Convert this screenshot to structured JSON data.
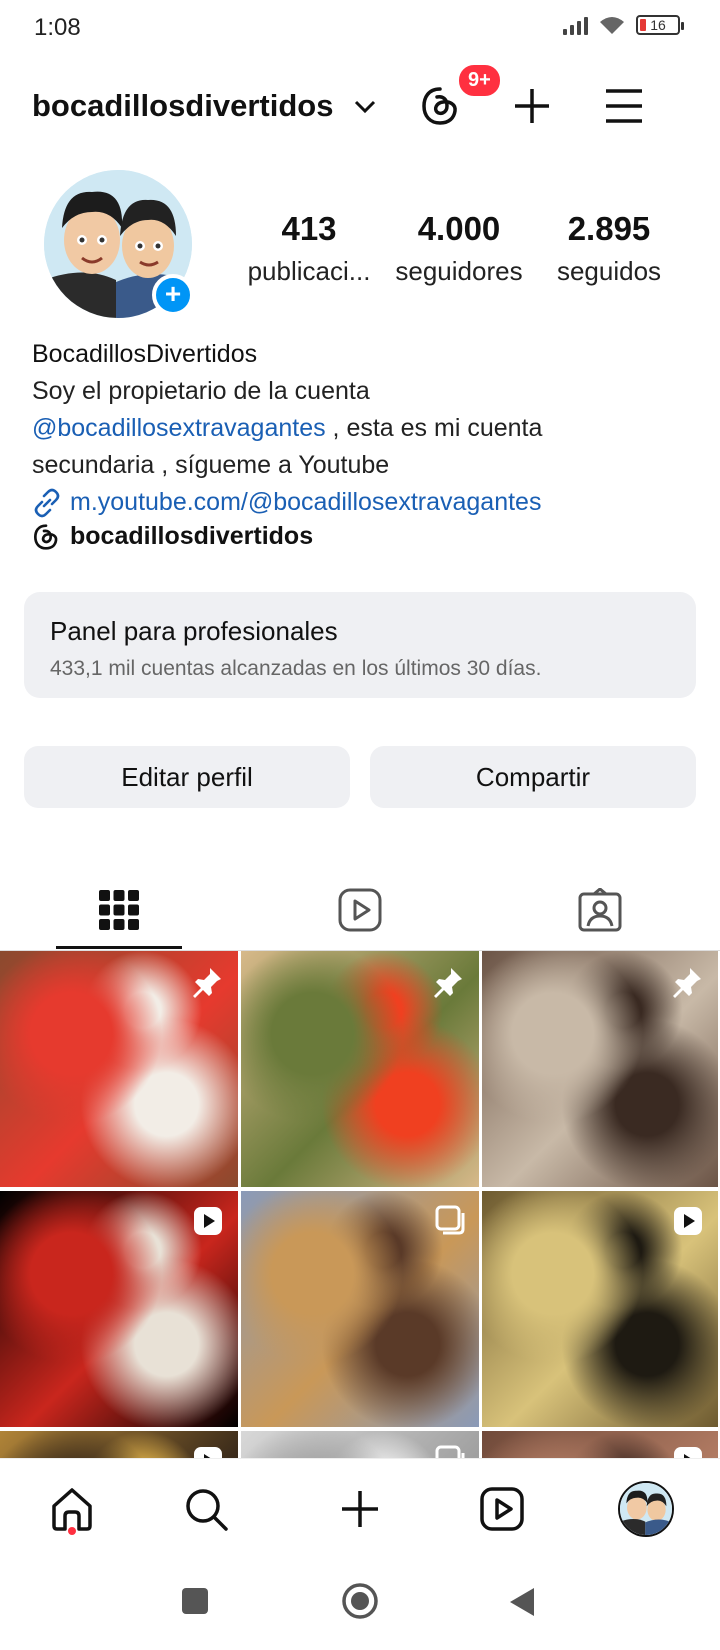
{
  "status_bar": {
    "time": "1:08",
    "battery": "16"
  },
  "header": {
    "username": "bocadillosdivertidos",
    "threads_badge": "9+",
    "icons": [
      "chevron-down-icon",
      "threads-icon",
      "plus-icon",
      "menu-icon"
    ]
  },
  "profile": {
    "stats": [
      {
        "value": "413",
        "label": "publicaci..."
      },
      {
        "value": "4.000",
        "label": "seguidores"
      },
      {
        "value": "2.895",
        "label": "seguidos"
      }
    ],
    "name": "BocadillosDivertidos",
    "bio_line1": "Soy el propietario de la cuenta",
    "bio_mention": "@bocadillosextravagantes",
    "bio_line2_rest": " , esta es mi cuenta",
    "bio_line3": "secundaria , sígueme a Youtube",
    "link": "m.youtube.com/@bocadillosextravagantes",
    "threads_handle": "bocadillosdivertidos"
  },
  "pro_panel": {
    "title": "Panel para profesionales",
    "subtitle": "433,1 mil cuentas alcanzadas en los últimos 30 días."
  },
  "actions": {
    "edit": "Editar perfil",
    "share": "Compartir"
  },
  "tabs": [
    "grid-icon",
    "reels-icon",
    "tagged-icon"
  ],
  "grid": [
    {
      "icon": "pin-icon",
      "colors": [
        "#8a4a2e",
        "#e63a2e",
        "#f2ede6"
      ]
    },
    {
      "icon": "pin-icon",
      "colors": [
        "#d7b98a",
        "#6a7a3a",
        "#f04020"
      ]
    },
    {
      "icon": "pin-icon",
      "colors": [
        "#6b5446",
        "#c8b9a7",
        "#3a2a22"
      ]
    },
    {
      "icon": "reel-icon",
      "colors": [
        "#000000",
        "#c9261d",
        "#e8e1d6"
      ]
    },
    {
      "icon": "carousel-icon",
      "colors": [
        "#8a9ab8",
        "#c99858",
        "#5a3a28"
      ]
    },
    {
      "icon": "reel-icon",
      "colors": [
        "#6d5a30",
        "#d8c27a",
        "#1e1a12"
      ]
    },
    {
      "icon": "reel-icon",
      "colors": [
        "#b08438",
        "#3a2a1a",
        "#f0c050"
      ]
    },
    {
      "icon": "carousel-icon",
      "colors": [
        "#d8d8d8",
        "#a0a0a0",
        "#f4f4f4"
      ]
    },
    {
      "icon": "reel-icon",
      "colors": [
        "#704a3a",
        "#b07a62",
        "#3a2620"
      ]
    }
  ],
  "bottom_nav": [
    "home-icon",
    "search-icon",
    "create-icon",
    "reels-icon",
    "profile-avatar"
  ],
  "system_nav": [
    "recents-button",
    "home-button",
    "back-button"
  ],
  "colors": {
    "link": "#1a5fb4",
    "badge": "#ff3040",
    "blue": "#0095f6",
    "panel": "#eff0f3"
  }
}
